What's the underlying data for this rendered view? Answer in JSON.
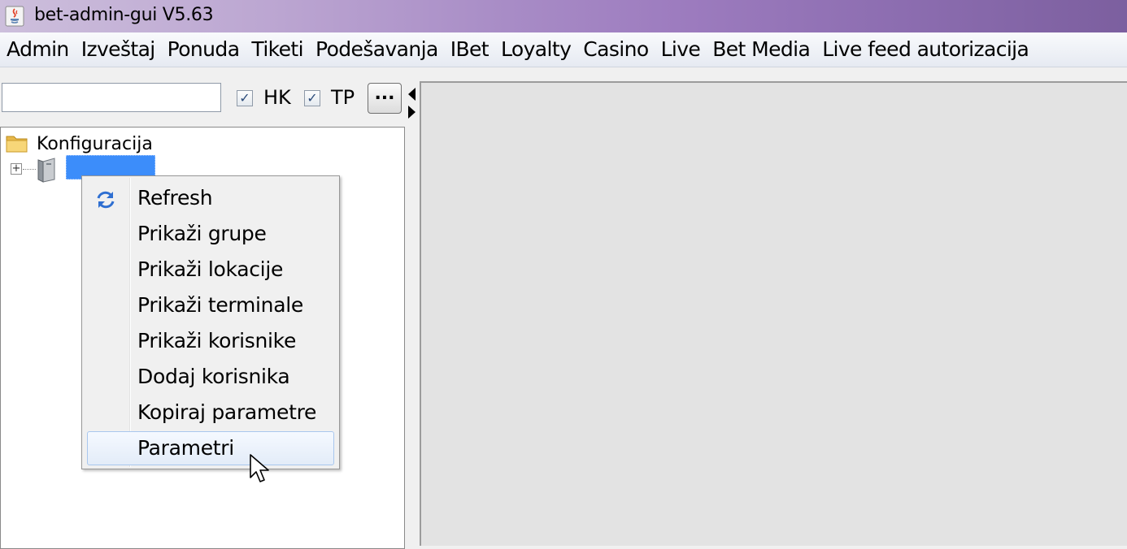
{
  "window": {
    "title": "bet-admin-gui V5.63",
    "app_icon": "java-icon"
  },
  "menubar": {
    "items": [
      "Admin",
      "Izveštaj",
      "Ponuda",
      "Tiketi",
      "Podešavanja",
      "IBet",
      "Loyalty",
      "Casino",
      "Live",
      "Bet Media",
      "Live feed autorizacija"
    ]
  },
  "toolbar": {
    "search_value": "",
    "hk": {
      "label": "HK",
      "checked": true
    },
    "tp": {
      "label": "TP",
      "checked": true
    },
    "more_label": "..."
  },
  "tree": {
    "root_label": "Konfiguracija",
    "child_label": ""
  },
  "context_menu": {
    "items": [
      "Refresh",
      "Prikaži grupe",
      "Prikaži lokacije",
      "Prikaži terminale",
      "Prikaži korisnike",
      "Dodaj korisnika",
      "Kopiraj parametre",
      "Parametri"
    ],
    "hovered": "Parametri"
  },
  "colors": {
    "selection": "#3c8dfa",
    "titlebar": "#a88cc6",
    "content_bg": "#e3e3e3"
  }
}
